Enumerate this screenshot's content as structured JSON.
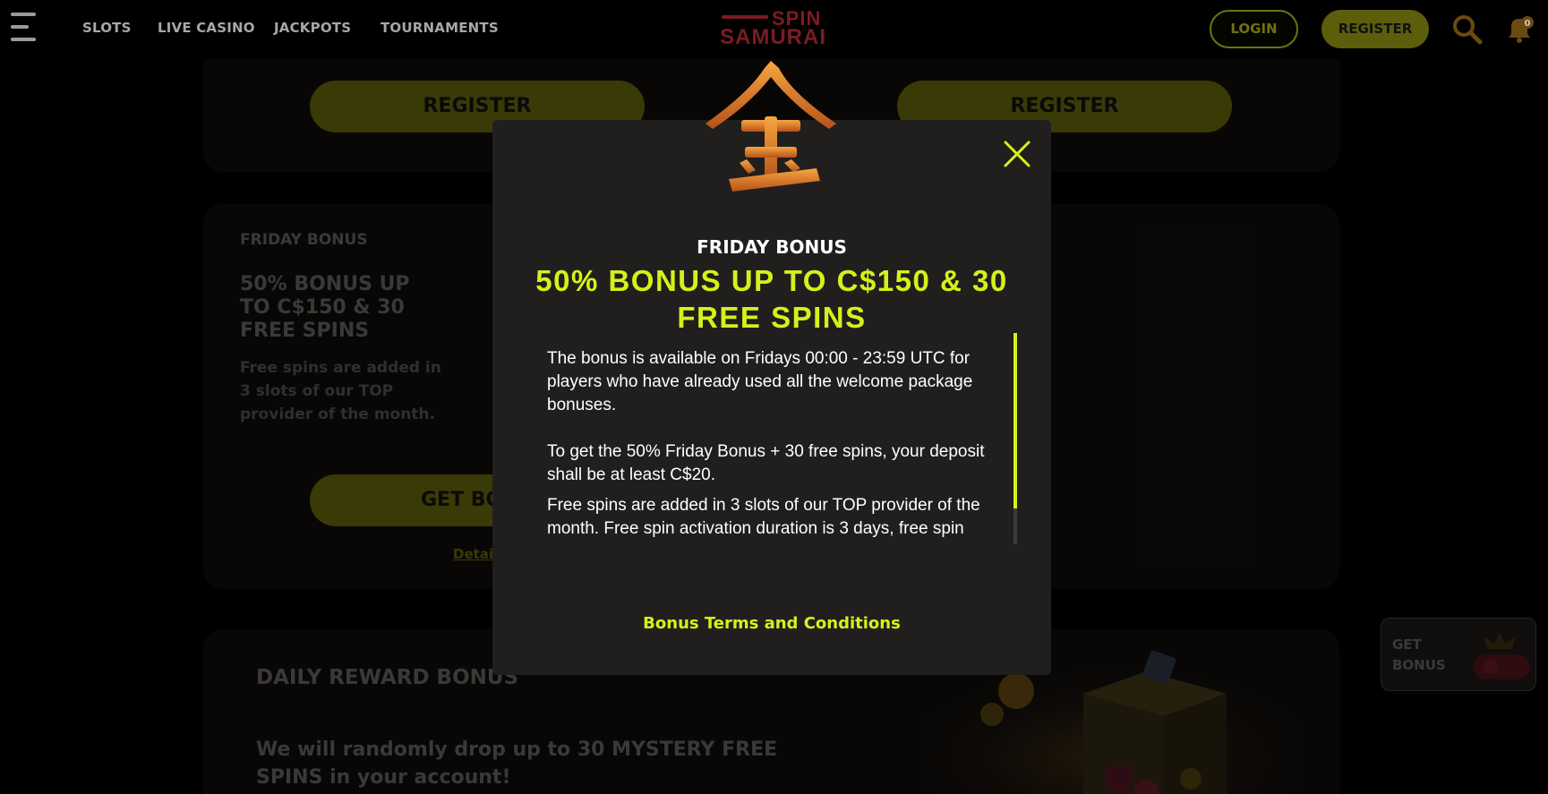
{
  "header": {
    "nav": [
      "SLOTS",
      "LIVE CASINO",
      "JACKPOTS",
      "TOURNAMENTS"
    ],
    "logo": [
      "SPIN",
      "SAMURAI"
    ],
    "login_label": "LOGIN",
    "register_label": "REGISTER",
    "notification_count": "0",
    "icons": [
      "menu-icon",
      "search-icon",
      "bell-icon"
    ]
  },
  "background": {
    "register_buttons": [
      "REGISTER",
      "REGISTER"
    ],
    "friday_card": {
      "label": "FRIDAY BONUS",
      "title": "50% BONUS UP TO C$150 & 30 FREE SPINS",
      "description": "Free spins are added in 3 slots of our TOP provider of the month.",
      "get_bonus_label": "GET BONUS",
      "details_label": "Details"
    },
    "daily_card": {
      "title": "DAILY REWARD BONUS",
      "description": "We will randomly drop up to 30 MYSTERY FREE SPINS in your account!"
    },
    "floating_bonus_label": "GET BONUS"
  },
  "modal": {
    "label": "FRIDAY BONUS",
    "title": "50% BONUS UP TO C$150 & 30 FREE SPINS",
    "paragraphs": [
      "The bonus is available on Fridays 00:00 - 23:59 UTC for players who have already used all the welcome package bonuses.",
      "To get the 50% Friday Bonus + 30 free spins, your deposit shall be at least C$20.",
      "Free spins are added in 3 slots of our TOP provider of the month. Free spin activation duration is 3 days, free spin"
    ],
    "terms_label": "Bonus Terms and Conditions",
    "scroll_position": 0.0
  },
  "colors": {
    "accent": "#d3f21a",
    "muted_accent": "#5c5e0b",
    "modal_bg": "#211f1e",
    "brand_red": "#7c1b24"
  }
}
